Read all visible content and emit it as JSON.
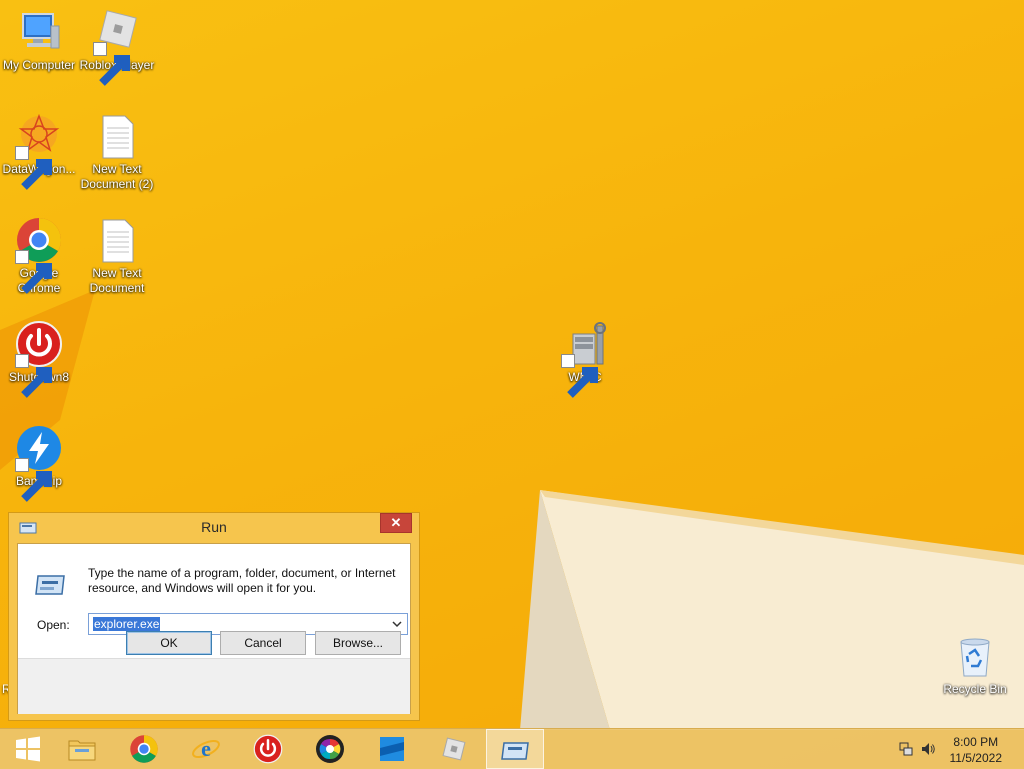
{
  "desktop": {
    "icons": [
      {
        "label": "My Computer",
        "icon": "computer-icon"
      },
      {
        "label": "Roblox Player",
        "icon": "roblox-icon"
      },
      {
        "label": "DataWagon...",
        "icon": "datawagon-icon"
      },
      {
        "label": "New Text Document (2)",
        "icon": "text-document-icon"
      },
      {
        "label": "Google Chrome",
        "icon": "chrome-icon"
      },
      {
        "label": "New Text Document",
        "icon": "text-document-icon"
      },
      {
        "label": "Shutdown8",
        "icon": "power-icon"
      },
      {
        "label": "WMIC",
        "icon": "wmic-icon"
      },
      {
        "label": "Bandizip",
        "icon": "bandizip-icon"
      },
      {
        "label": "Recycle Bin",
        "icon": "recycle-bin-icon"
      }
    ],
    "partial_label": "R"
  },
  "run_dialog": {
    "title": "Run",
    "close_label": "✕",
    "description": "Type the name of a program, folder, document, or Internet resource, and Windows will open it for you.",
    "open_label": "Open:",
    "open_value": "explorer.exe",
    "ok_label": "OK",
    "cancel_label": "Cancel",
    "browse_label": "Browse..."
  },
  "taskbar": {
    "buttons": [
      {
        "name": "start-button",
        "icon": "windows-logo-icon"
      },
      {
        "name": "file-explorer",
        "icon": "folder-icon"
      },
      {
        "name": "chrome",
        "icon": "chrome-icon"
      },
      {
        "name": "internet-explorer",
        "icon": "ie-icon"
      },
      {
        "name": "shutdown8",
        "icon": "power-icon"
      },
      {
        "name": "color-app",
        "icon": "color-wheel-icon"
      },
      {
        "name": "roblox-studio",
        "icon": "roblox-studio-icon"
      },
      {
        "name": "roblox-player",
        "icon": "roblox-icon"
      },
      {
        "name": "run",
        "icon": "run-icon"
      }
    ],
    "time": "8:00 PM",
    "date": "11/5/2022"
  },
  "colors": {
    "wallpaper": "#f7b40c",
    "dialog_frame": "#f6c54d",
    "close_button": "#c7453a",
    "selection": "#3a78d8"
  }
}
